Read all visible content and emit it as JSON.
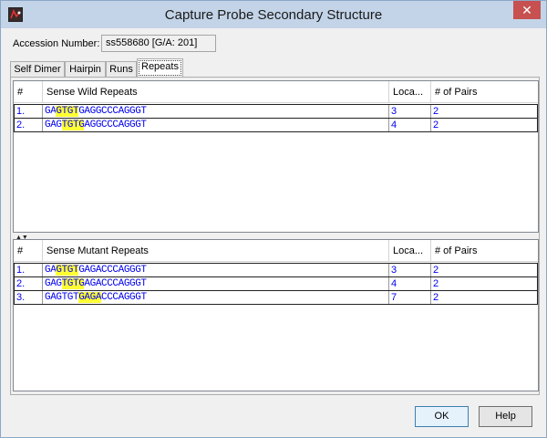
{
  "window": {
    "title": "Capture Probe Secondary Structure",
    "close_glyph": "✕"
  },
  "accession": {
    "label": "Accession Number:",
    "value": "ss558680 [G/A: 201]"
  },
  "tabs": [
    "Self Dimer",
    "Hairpin",
    "Runs",
    "Repeats"
  ],
  "active_tab": "Repeats",
  "wild_table": {
    "headers": [
      "#",
      "Sense Wild Repeats",
      "Loca...",
      "# of Pairs"
    ],
    "rows": [
      {
        "num": "1.",
        "seq_pre": "GA",
        "seq_hl": "GTGT",
        "seq_post": "GAGGCCCAGGGT",
        "location": "3",
        "pairs": "2"
      },
      {
        "num": "2.",
        "seq_pre": "GAG",
        "seq_hl": "TGTG",
        "seq_post": "AGGCCCAGGGT",
        "location": "4",
        "pairs": "2"
      }
    ]
  },
  "mutant_table": {
    "headers": [
      "#",
      "Sense Mutant Repeats",
      "Loca...",
      "# of Pairs"
    ],
    "rows": [
      {
        "num": "1.",
        "seq_pre": "GA",
        "seq_hl": "GTGT",
        "seq_post": "GAGACCCAGGGT",
        "location": "3",
        "pairs": "2"
      },
      {
        "num": "2.",
        "seq_pre": "GAG",
        "seq_hl": "TGTG",
        "seq_post": "AGACCCAGGGT",
        "location": "4",
        "pairs": "2"
      },
      {
        "num": "3.",
        "seq_pre": "GAGTGT",
        "seq_hl": "GAGA",
        "seq_post": "CCCAGGGT",
        "location": "7",
        "pairs": "2"
      }
    ]
  },
  "splitter_glyph": "▲▼",
  "buttons": {
    "ok": "OK",
    "help": "Help"
  },
  "colors": {
    "highlight": "#ffff33",
    "link_text": "#0000ee",
    "titlebar": "#c3d4e8",
    "close": "#c75050"
  }
}
